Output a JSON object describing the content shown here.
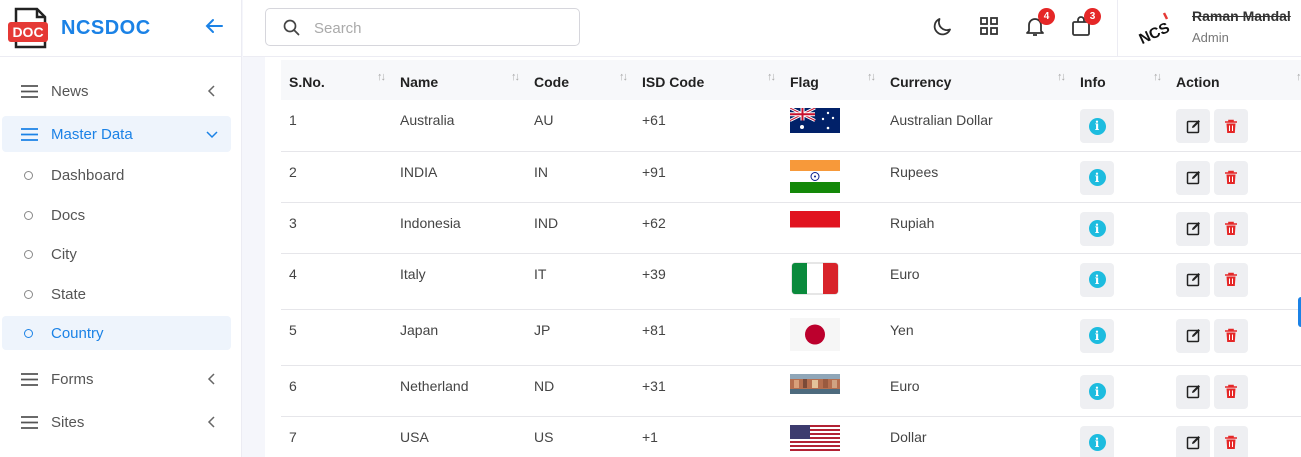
{
  "brand": {
    "name": "NCSDOC",
    "logo_text": "DOC"
  },
  "sidebar": {
    "items": [
      {
        "label": "News"
      },
      {
        "label": "Master Data"
      },
      {
        "label": "Forms"
      },
      {
        "label": "Sites"
      }
    ],
    "sub_items": [
      {
        "label": "Dashboard"
      },
      {
        "label": "Docs"
      },
      {
        "label": "City"
      },
      {
        "label": "State"
      },
      {
        "label": "Country"
      }
    ]
  },
  "search": {
    "placeholder": "Search",
    "value": ""
  },
  "topbar": {
    "notifications_count": "4",
    "cart_count": "3",
    "user": {
      "name": "Raman Mandal",
      "role": "Admin",
      "avatar_text": "NCS"
    }
  },
  "table": {
    "headers": [
      "S.No.",
      "Name",
      "Code",
      "ISD Code",
      "Flag",
      "Currency",
      "Info",
      "Action"
    ],
    "rows": [
      {
        "sno": "1",
        "name": "Australia",
        "code": "AU",
        "isd": "+61",
        "flag": "australia-flag",
        "currency": "Australian Dollar"
      },
      {
        "sno": "2",
        "name": "INDIA",
        "code": "IN",
        "isd": "+91",
        "flag": "india-flag",
        "currency": "Rupees"
      },
      {
        "sno": "3",
        "name": "Indonesia",
        "code": "IND",
        "isd": "+62",
        "flag": "indonesia-flag",
        "currency": "Rupiah"
      },
      {
        "sno": "4",
        "name": "Italy",
        "code": "IT",
        "isd": "+39",
        "flag": "italy-flag",
        "currency": "Euro"
      },
      {
        "sno": "5",
        "name": "Japan",
        "code": "JP",
        "isd": "+81",
        "flag": "japan-flag",
        "currency": "Yen"
      },
      {
        "sno": "6",
        "name": "Netherland",
        "code": "ND",
        "isd": "+31",
        "flag": "netherland-photo",
        "currency": "Euro"
      },
      {
        "sno": "7",
        "name": "USA",
        "code": "US",
        "isd": "+1",
        "flag": "usa-flag",
        "currency": "Dollar"
      }
    ]
  },
  "colors": {
    "accent": "#1b82e6",
    "badge": "#e52727",
    "info": "#1dbcdf",
    "delete": "#e52727"
  }
}
